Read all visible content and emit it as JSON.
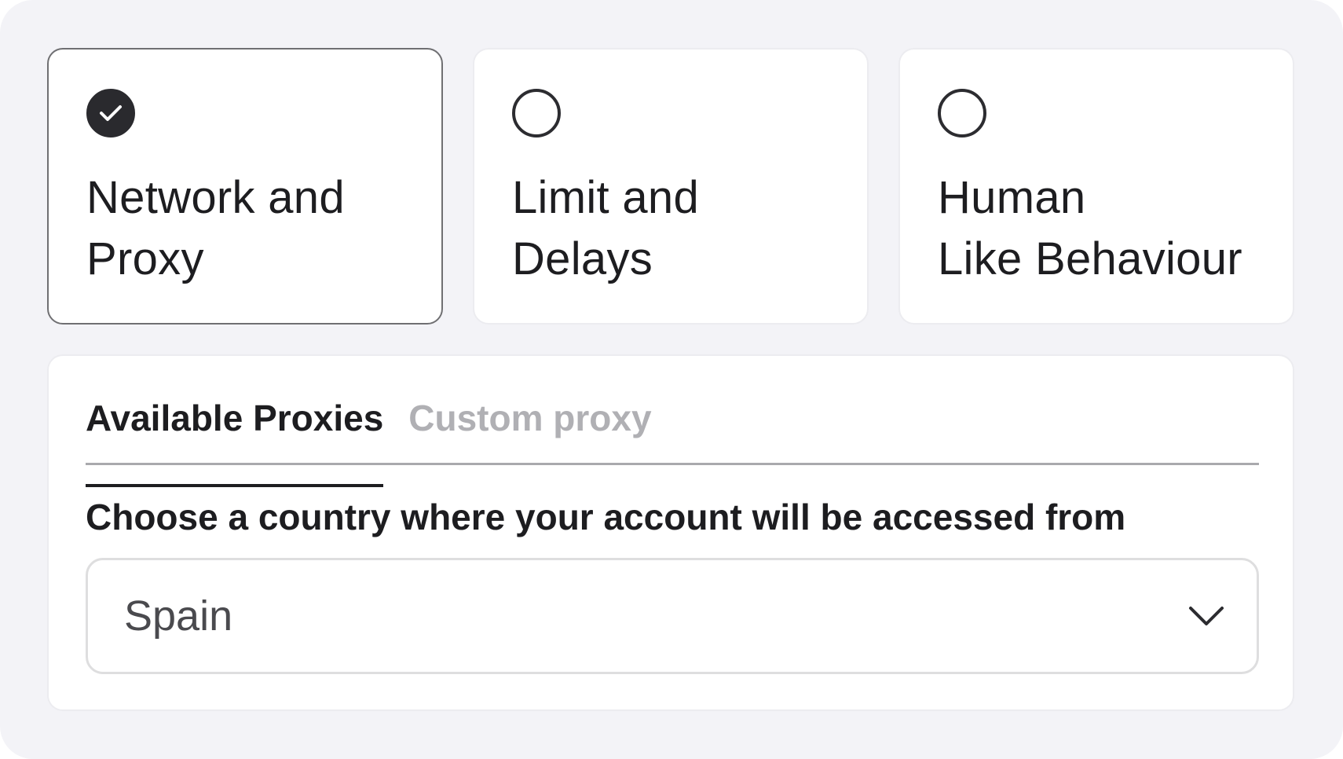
{
  "options": [
    {
      "label": "Network and\nProxy",
      "selected": true
    },
    {
      "label": "Limit and\nDelays",
      "selected": false
    },
    {
      "label": "Human\nLike Behaviour",
      "selected": false
    }
  ],
  "tabs": [
    {
      "label": "Available Proxies",
      "active": true
    },
    {
      "label": "Custom proxy",
      "active": false
    }
  ],
  "country_field": {
    "label": "Choose a country where your account will be accessed from",
    "value": "Spain"
  },
  "icons": {
    "selected_radio": "check-circle-icon",
    "unselected_radio": "empty-circle-icon",
    "select_chevron": "chevron-down-icon"
  },
  "colors": {
    "panel_background": "#f3f3f7",
    "card_background": "#ffffff",
    "accent_dark": "#2a2a2e",
    "inactive_tab": "#b0b0b4"
  }
}
